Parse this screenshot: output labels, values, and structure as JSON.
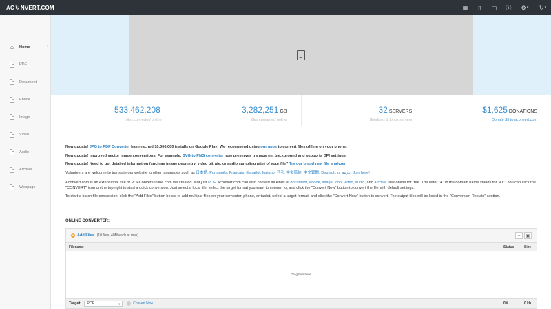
{
  "brand": {
    "logo_left": "AC",
    "logo_right": "NVERT.COM"
  },
  "topnav": {
    "icons": [
      "grid-icon",
      "mobile-icon",
      "monitor-icon",
      "help-icon",
      "settings-icon",
      "refresh-icon"
    ]
  },
  "sidebar": {
    "items": [
      {
        "label": "Home",
        "active": true
      },
      {
        "label": "PDF"
      },
      {
        "label": "Document"
      },
      {
        "label": "Ebook"
      },
      {
        "label": "Image"
      },
      {
        "label": "Video"
      },
      {
        "label": "Audio"
      },
      {
        "label": "Archive"
      },
      {
        "label": "Webpage"
      }
    ]
  },
  "stats": [
    {
      "value": "533,462,208",
      "unit": "",
      "sub": "files converted online"
    },
    {
      "value": "3,282,251",
      "unit": "GB",
      "sub": "files converted online"
    },
    {
      "value": "32",
      "unit": "SERVERS",
      "sub": "Windows & Linux servers"
    },
    {
      "value": "$1,625",
      "unit": "DONATIONS",
      "sub": "Donate $5 to aconvert.com"
    }
  ],
  "news": {
    "n1_a": "New update! ",
    "n1_link": "JPG to PDF Converter",
    "n1_b": " has reached 10,000,000 installs on Google Play! We recommend using ",
    "n1_link2": "our apps",
    "n1_c": " to convert files offline on your phone.",
    "n2_a": "New update! Improved vector image conversions. For example: ",
    "n2_link": "SVG to PNG converter",
    "n2_b": " now preserves transparent background and supports DPI settings.",
    "n3_a": "New update! Need to get detailed information (such as image geometry, video bitrate, or audio sampling rate) of your file? ",
    "n3_link": "Try our brand new file analyzer.",
    "vol_a": "Volunteers are welcome to translate our website to other languages such as ",
    "vol_langs": "日本語, Português, Français, Español, Italiano, 한국, 中文简体, 中文繁體, Deutsch, or عربية.",
    "vol_link": " Join here!",
    "desc_a": "Aconvert.com is an extensional site of PDFConvertOnline.com we created. Not just ",
    "desc_pdf": "PDF",
    "desc_b": ", Aconvert.com can also convert all kinds of ",
    "desc_links": "document, ebook, image, icon, video, audio,",
    "desc_c": " and ",
    "desc_archive": "archive",
    "desc_d": " files online for free. The letter \"A\" in the domain name stands for \"All\". You can click the \"CONVERT\" icon on the top-right to start a quick conversion: Just select a local file, select the target format you want to convert to, and click the \"Convert Now\" button to convert the file with default settings.",
    "batch": "To start a batch file conversion, click the \"Add Files\" button below to add multiple files on your computer, phone, or tablet, select a target format, and click the \"Convert Now\" button to convert. The output files will be listed in the \"Conversion Results\" section."
  },
  "converter": {
    "title": "ONLINE CONVERTER:",
    "add_files": "Add Files",
    "add_note": "(10 files, 40M each at max)",
    "col_filename": "Filename",
    "col_status": "Status",
    "col_size": "Size",
    "drop_text": "Drag files here.",
    "target_label": "Target:",
    "target_value": "PDF",
    "convert_now": "Convert Now",
    "pct": "0%",
    "size": "0 kb"
  }
}
